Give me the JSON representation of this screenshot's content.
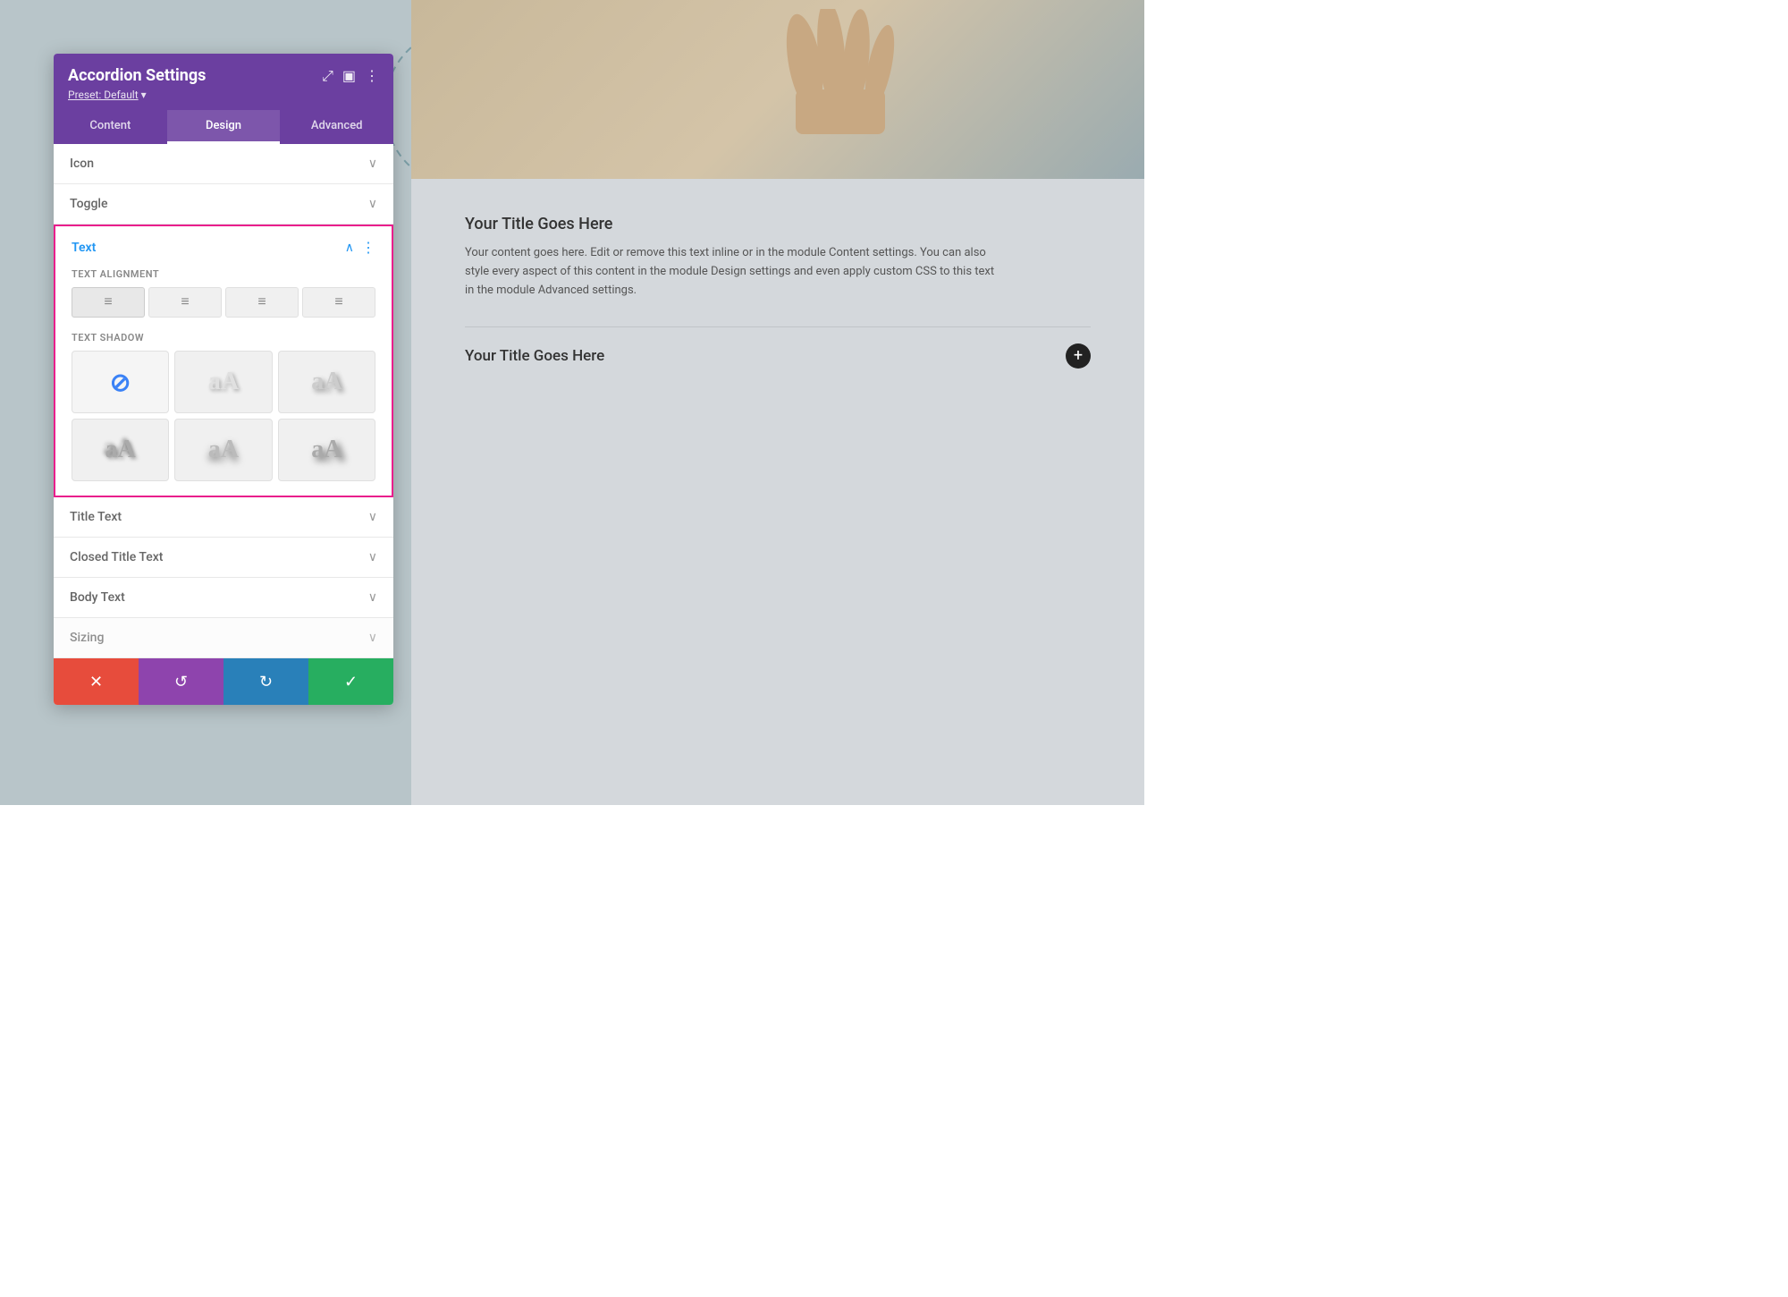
{
  "panel": {
    "title": "Accordion Settings",
    "preset": "Preset: Default",
    "tabs": [
      {
        "id": "content",
        "label": "Content",
        "active": false
      },
      {
        "id": "design",
        "label": "Design",
        "active": true
      },
      {
        "id": "advanced",
        "label": "Advanced",
        "active": false
      }
    ],
    "sections": {
      "icon": {
        "label": "Icon",
        "collapsed": true
      },
      "toggle": {
        "label": "Toggle",
        "collapsed": true
      },
      "text": {
        "label": "Text",
        "expanded": true,
        "fields": {
          "text_alignment": {
            "label": "Text Alignment",
            "options": [
              "left",
              "center",
              "right",
              "justify"
            ]
          },
          "text_shadow": {
            "label": "Text Shadow",
            "options": [
              "none",
              "shadow1",
              "shadow2",
              "shadow3",
              "shadow4",
              "shadow5"
            ]
          }
        }
      },
      "title_text": {
        "label": "Title Text",
        "collapsed": true
      },
      "closed_title_text": {
        "label": "Closed Title Text",
        "collapsed": true
      },
      "body_text": {
        "label": "Body Text",
        "collapsed": true
      },
      "sizing": {
        "label": "Sizing",
        "collapsed": true
      }
    },
    "footer": {
      "cancel_label": "✕",
      "undo_label": "↺",
      "redo_label": "↻",
      "save_label": "✓"
    }
  },
  "main_content": {
    "accordion_open": {
      "title": "Your Title Goes Here",
      "body": "Your content goes here. Edit or remove this text inline or in the module Content settings. You can also style every aspect of this content in the module Design settings and even apply custom CSS to this text in the module Advanced settings."
    },
    "accordion_closed": {
      "title": "Your Title Goes Here"
    }
  },
  "icons": {
    "expand": "⤢",
    "collapse": "▣",
    "more": "⋮",
    "chevron_down": "›",
    "chevron_up": "‹",
    "plus": "+"
  }
}
